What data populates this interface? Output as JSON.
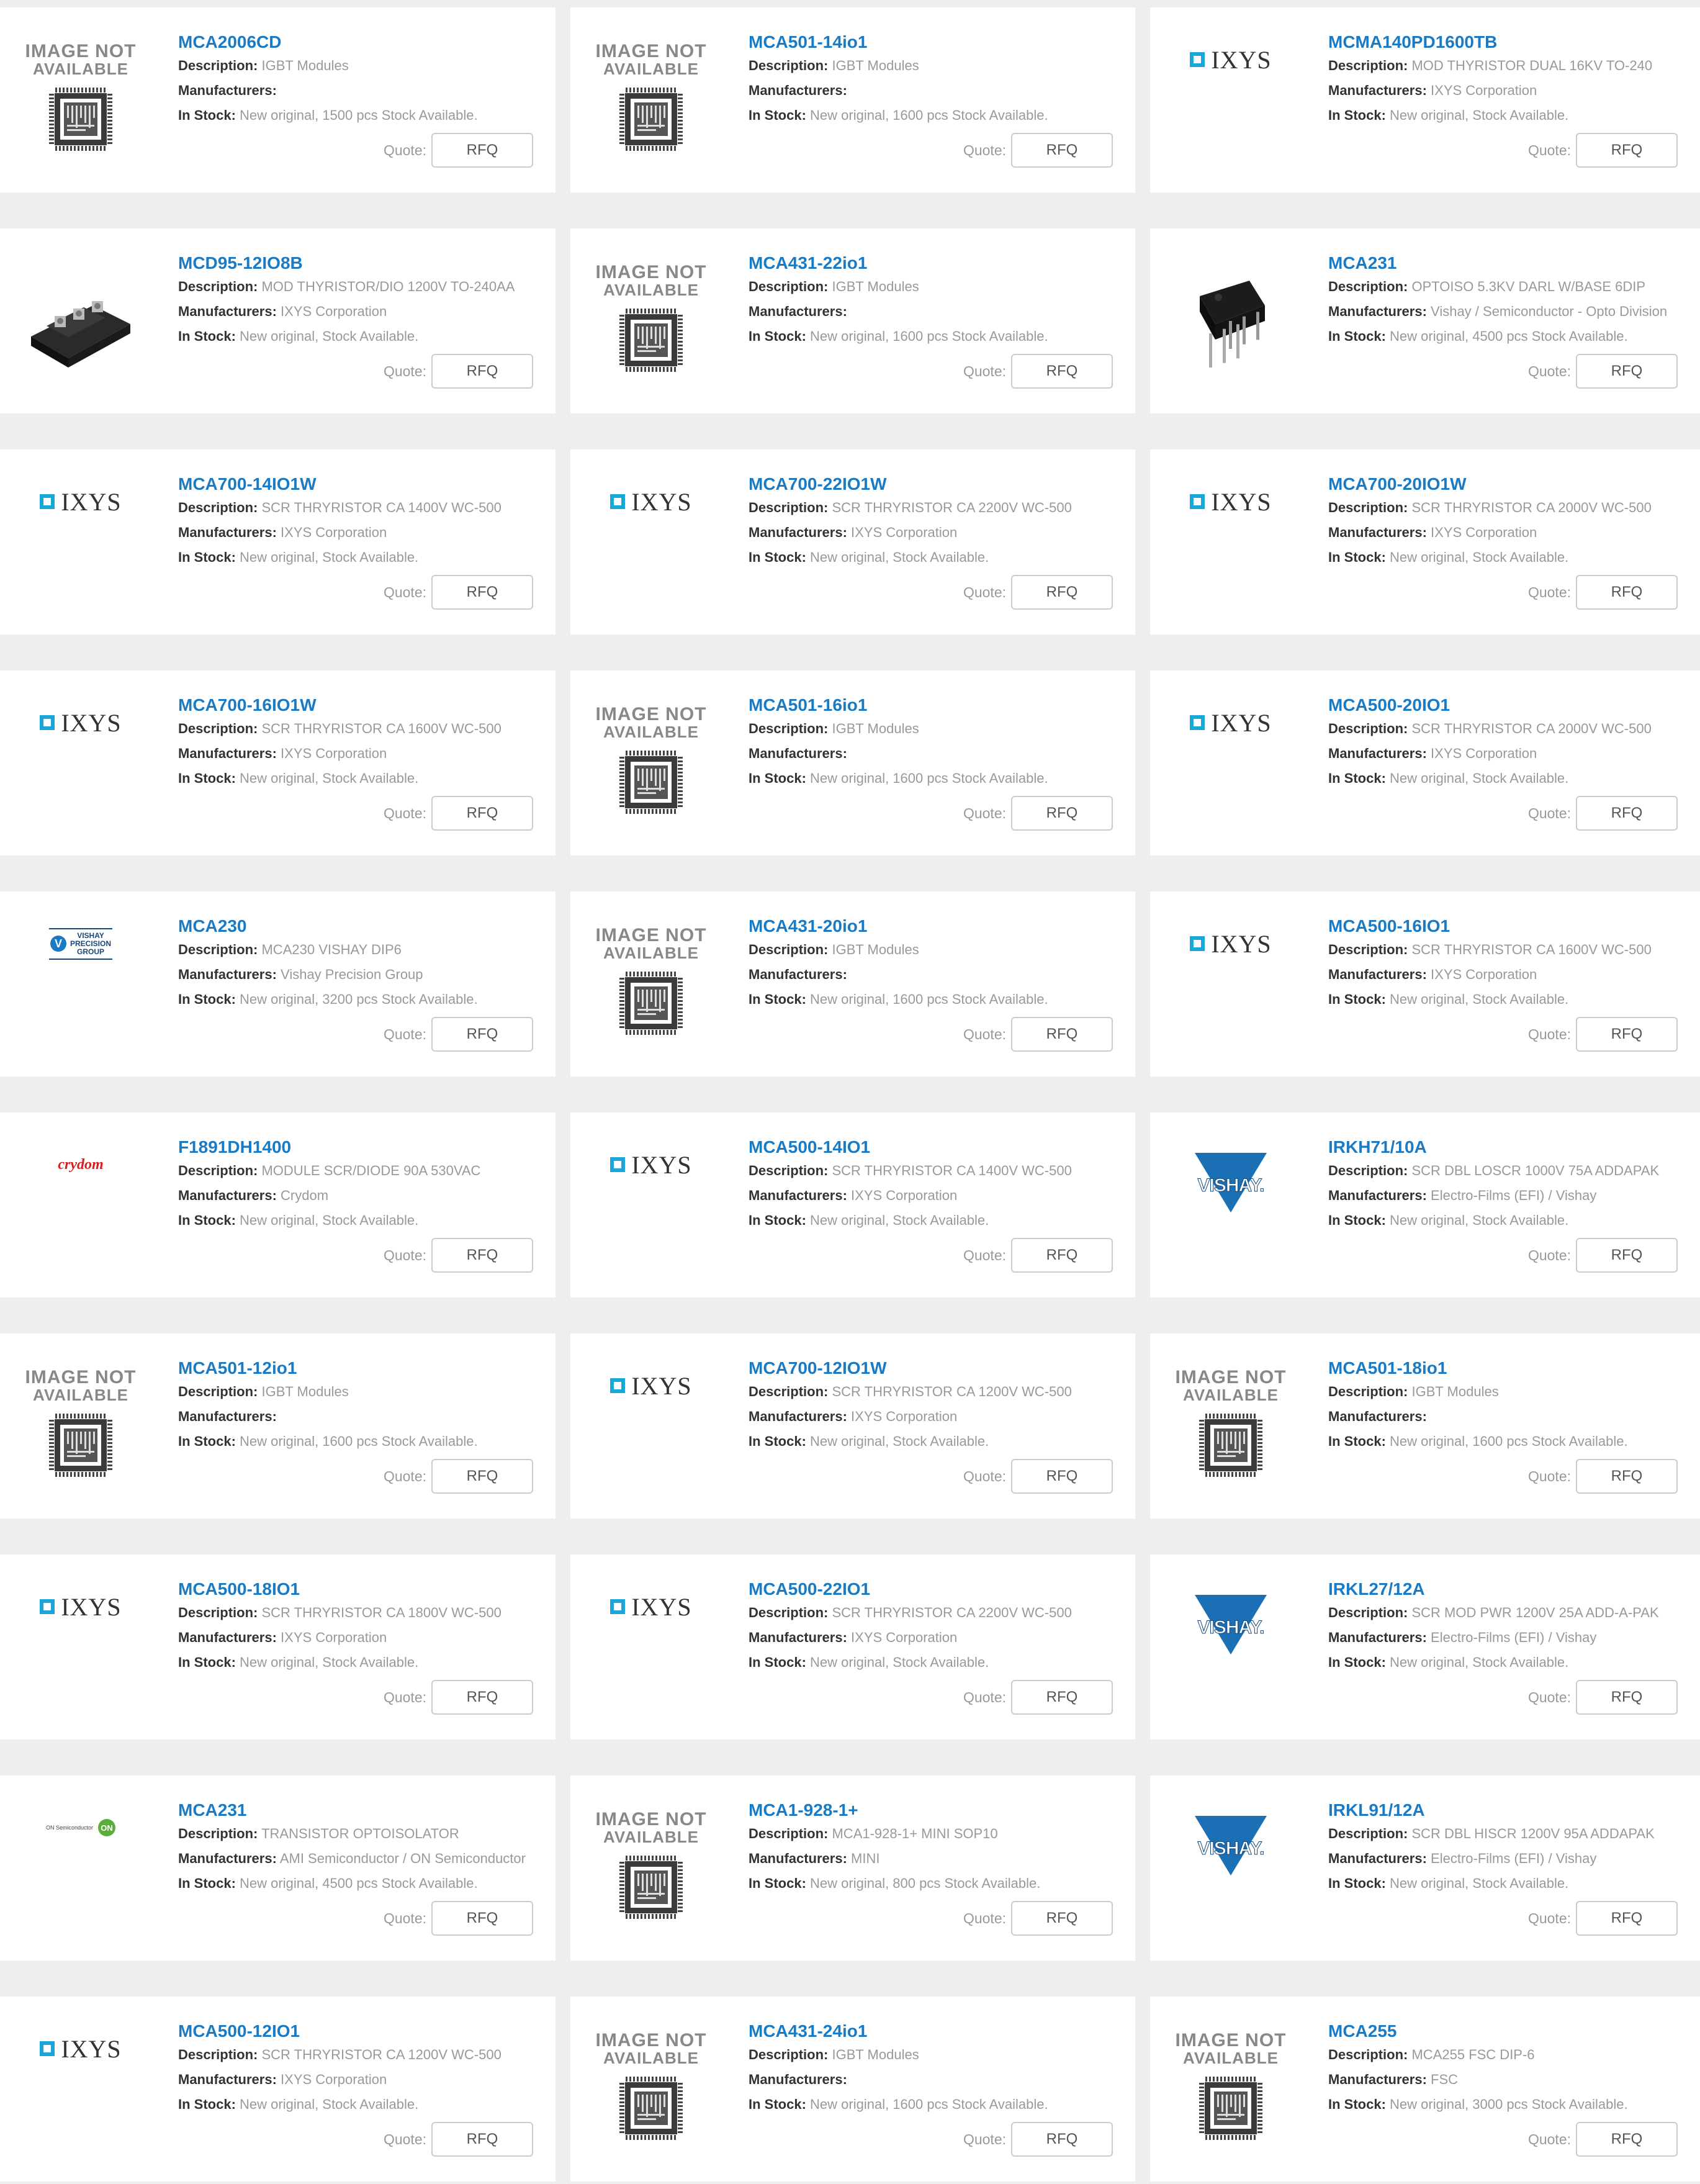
{
  "labels": {
    "description": "Description:",
    "manufacturers": "Manufacturers:",
    "in_stock": "In Stock:",
    "quote": "Quote:",
    "rfq": "RFQ",
    "image_not": "IMAGE NOT",
    "available": "AVAILABLE"
  },
  "logos": {
    "ixys": "IXYS",
    "vishay": "VISHAY.",
    "crydom": "crydom",
    "vpg_top": "VISHAY",
    "vpg_1": "PRECISION",
    "vpg_2": "GROUP",
    "on_small": "ON Semiconductor",
    "on_mark": "ON"
  },
  "colors": {
    "link": "#1a7ac4",
    "ixys_square": "#19a6d8",
    "vishay": "#16487a",
    "crydom": "#d42020",
    "page_bg": "#eeeeee"
  },
  "products": [
    {
      "part": "MCA2006CD",
      "desc": "IGBT Modules",
      "mfr": "",
      "stock": "New original, 1500 pcs Stock Available.",
      "image": "not-available"
    },
    {
      "part": "MCA501-14io1",
      "desc": "IGBT Modules",
      "mfr": "",
      "stock": "New original, 1600 pcs Stock Available.",
      "image": "not-available"
    },
    {
      "part": "MCMA140PD1600TB",
      "desc": "MOD THYRISTOR DUAL 16KV TO-240",
      "mfr": "IXYS Corporation",
      "stock": "New original, Stock Available.",
      "image": "ixys"
    },
    {
      "part": "MCD95-12IO8B",
      "desc": "MOD THYRISTOR/DIO 1200V TO-240AA",
      "mfr": "IXYS Corporation",
      "stock": "New original, Stock Available.",
      "image": "module-photo"
    },
    {
      "part": "MCA431-22io1",
      "desc": "IGBT Modules",
      "mfr": "",
      "stock": "New original, 1600 pcs Stock Available.",
      "image": "not-available"
    },
    {
      "part": "MCA231",
      "desc": "OPTOISO 5.3KV DARL W/BASE 6DIP",
      "mfr": "Vishay / Semiconductor - Opto Division",
      "stock": "New original, 4500 pcs Stock Available.",
      "image": "dip-photo"
    },
    {
      "part": "MCA700-14IO1W",
      "desc": "SCR THRYRISTOR CA 1400V WC-500",
      "mfr": "IXYS Corporation",
      "stock": "New original, Stock Available.",
      "image": "ixys"
    },
    {
      "part": "MCA700-22IO1W",
      "desc": "SCR THRYRISTOR CA 2200V WC-500",
      "mfr": "IXYS Corporation",
      "stock": "New original, Stock Available.",
      "image": "ixys"
    },
    {
      "part": "MCA700-20IO1W",
      "desc": "SCR THRYRISTOR CA 2000V WC-500",
      "mfr": "IXYS Corporation",
      "stock": "New original, Stock Available.",
      "image": "ixys"
    },
    {
      "part": "MCA700-16IO1W",
      "desc": "SCR THRYRISTOR CA 1600V WC-500",
      "mfr": "IXYS Corporation",
      "stock": "New original, Stock Available.",
      "image": "ixys"
    },
    {
      "part": "MCA501-16io1",
      "desc": "IGBT Modules",
      "mfr": "",
      "stock": "New original, 1600 pcs Stock Available.",
      "image": "not-available"
    },
    {
      "part": "MCA500-20IO1",
      "desc": "SCR THRYRISTOR CA 2000V WC-500",
      "mfr": "IXYS Corporation",
      "stock": "New original, Stock Available.",
      "image": "ixys"
    },
    {
      "part": "MCA230",
      "desc": "MCA230 VISHAY DIP6",
      "mfr": "Vishay Precision Group",
      "stock": "New original, 3200 pcs Stock Available.",
      "image": "vpg"
    },
    {
      "part": "MCA431-20io1",
      "desc": "IGBT Modules",
      "mfr": "",
      "stock": "New original, 1600 pcs Stock Available.",
      "image": "not-available"
    },
    {
      "part": "MCA500-16IO1",
      "desc": "SCR THRYRISTOR CA 1600V WC-500",
      "mfr": "IXYS Corporation",
      "stock": "New original, Stock Available.",
      "image": "ixys"
    },
    {
      "part": "F1891DH1400",
      "desc": "MODULE SCR/DIODE 90A 530VAC",
      "mfr": "Crydom",
      "stock": "New original, Stock Available.",
      "image": "crydom"
    },
    {
      "part": "MCA500-14IO1",
      "desc": "SCR THRYRISTOR CA 1400V WC-500",
      "mfr": "IXYS Corporation",
      "stock": "New original, Stock Available.",
      "image": "ixys"
    },
    {
      "part": "IRKH71/10A",
      "desc": "SCR DBL LOSCR 1000V 75A ADDAPAK",
      "mfr": "Electro-Films (EFI) / Vishay",
      "stock": "New original, Stock Available.",
      "image": "vishay"
    },
    {
      "part": "MCA501-12io1",
      "desc": "IGBT Modules",
      "mfr": "",
      "stock": "New original, 1600 pcs Stock Available.",
      "image": "not-available"
    },
    {
      "part": "MCA700-12IO1W",
      "desc": "SCR THRYRISTOR CA 1200V WC-500",
      "mfr": "IXYS Corporation",
      "stock": "New original, Stock Available.",
      "image": "ixys"
    },
    {
      "part": "MCA501-18io1",
      "desc": "IGBT Modules",
      "mfr": "",
      "stock": "New original, 1600 pcs Stock Available.",
      "image": "not-available"
    },
    {
      "part": "MCA500-18IO1",
      "desc": "SCR THRYRISTOR CA 1800V WC-500",
      "mfr": "IXYS Corporation",
      "stock": "New original, Stock Available.",
      "image": "ixys"
    },
    {
      "part": "MCA500-22IO1",
      "desc": "SCR THRYRISTOR CA 2200V WC-500",
      "mfr": "IXYS Corporation",
      "stock": "New original, Stock Available.",
      "image": "ixys"
    },
    {
      "part": "IRKL27/12A",
      "desc": "SCR MOD PWR 1200V 25A ADD-A-PAK",
      "mfr": "Electro-Films (EFI) / Vishay",
      "stock": "New original, Stock Available.",
      "image": "vishay"
    },
    {
      "part": "MCA231",
      "desc": "TRANSISTOR OPTOISOLATOR",
      "mfr": "AMI Semiconductor / ON Semiconductor",
      "stock": "New original, 4500 pcs Stock Available.",
      "image": "on-semi"
    },
    {
      "part": "MCA1-928-1+",
      "desc": "MCA1-928-1+ MINI SOP10",
      "mfr": "MINI",
      "stock": "New original, 800 pcs Stock Available.",
      "image": "not-available"
    },
    {
      "part": "IRKL91/12A",
      "desc": "SCR DBL HISCR 1200V 95A ADDAPAK",
      "mfr": "Electro-Films (EFI) / Vishay",
      "stock": "New original, Stock Available.",
      "image": "vishay"
    },
    {
      "part": "MCA500-12IO1",
      "desc": "SCR THRYRISTOR CA 1200V WC-500",
      "mfr": "IXYS Corporation",
      "stock": "New original, Stock Available.",
      "image": "ixys"
    },
    {
      "part": "MCA431-24io1",
      "desc": "IGBT Modules",
      "mfr": "",
      "stock": "New original, 1600 pcs Stock Available.",
      "image": "not-available"
    },
    {
      "part": "MCA255",
      "desc": "MCA255 FSC DIP-6",
      "mfr": "FSC",
      "stock": "New original, 3000 pcs Stock Available.",
      "image": "not-available"
    }
  ]
}
